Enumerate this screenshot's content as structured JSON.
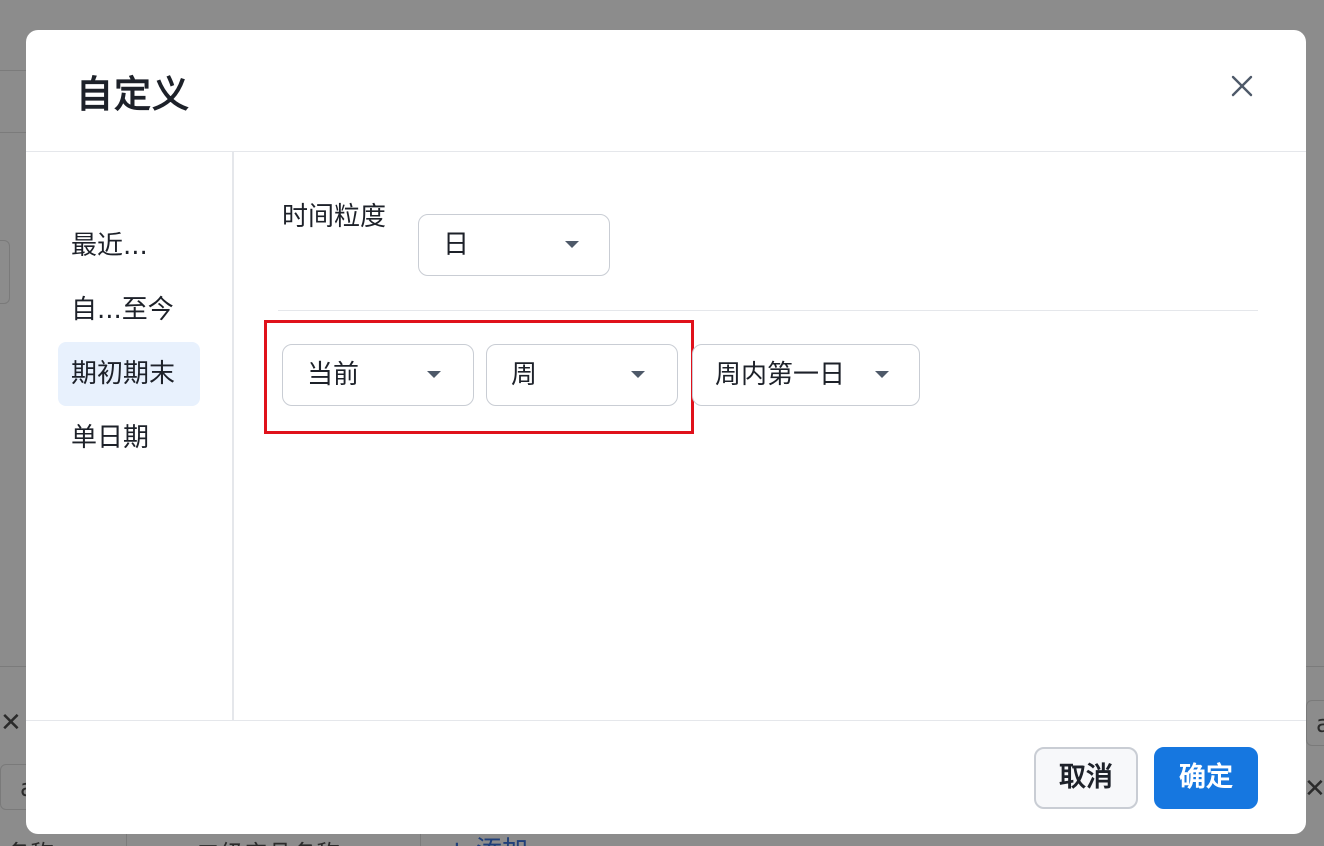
{
  "modal": {
    "title": "自定义",
    "close_icon": "close-icon"
  },
  "sidebar": {
    "items": [
      {
        "label": "最近..."
      },
      {
        "label": "自...至今"
      },
      {
        "label": "期初期末",
        "active": true
      },
      {
        "label": "单日期"
      }
    ]
  },
  "content": {
    "granularity_label": "时间粒度",
    "granularity_value": "日",
    "period_select": "当前",
    "unit_select": "周",
    "position_select": "周内第一日"
  },
  "footer": {
    "cancel_label": "取消",
    "confirm_label": "确定"
  },
  "background": {
    "field_text_1": "名称",
    "field_text_2": "二级产品名称",
    "add_link": "+ 添加",
    "cut_char_right": "a",
    "cut_char_left": "a"
  },
  "colors": {
    "accent": "#1677e0",
    "highlight": "#e0111b",
    "active_bg": "#e8f1fd",
    "overlay": "#8c8c8c"
  }
}
